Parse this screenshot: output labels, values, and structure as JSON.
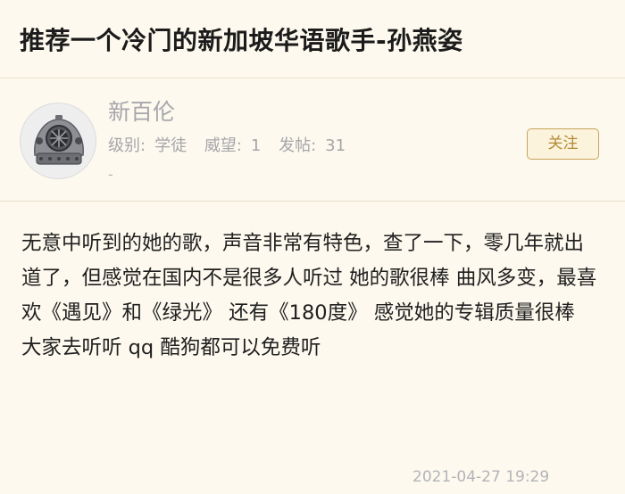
{
  "post": {
    "title": "推荐一个冷门的新加坡华语歌手-孙燕姿"
  },
  "author": {
    "avatar_icon": "diving-helmet-icon",
    "name": "新百伦",
    "level_label": "级别:",
    "level_value": "学徒",
    "prestige_label": "威望:",
    "prestige_value": "1",
    "posts_label": "发帖:",
    "posts_value": "31",
    "extra": "-",
    "follow_label": "关注"
  },
  "body": {
    "text": "无意中听到的她的歌，声音非常有特色，查了一下，零几年就出道了，但感觉在国内不是很多人听过 她的歌很棒 曲风多变，最喜欢《遇见》和《绿光》 还有《180度》 感觉她的专辑质量很棒 大家去听听 qq 酷狗都可以免费听"
  },
  "footer": {
    "timestamp": "2021-04-27 19:29"
  },
  "colors": {
    "background": "#fdf9ee",
    "accent": "#b48a36",
    "muted_text": "#a6a6aa"
  }
}
